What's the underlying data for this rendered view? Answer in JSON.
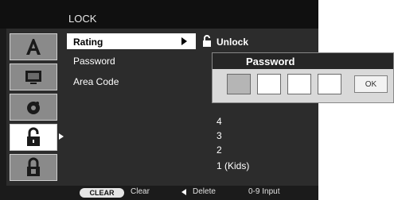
{
  "header": {
    "title": "LOCK"
  },
  "sidebar": {
    "tiles": [
      {
        "icon": "text-language-icon"
      },
      {
        "icon": "display-icon"
      },
      {
        "icon": "audio-disc-icon"
      },
      {
        "icon": "padlock-icon",
        "active": true
      },
      {
        "icon": "others-icon"
      }
    ]
  },
  "menu": {
    "items": [
      {
        "label": "Rating"
      },
      {
        "label": "Password"
      },
      {
        "label": "Area Code"
      }
    ]
  },
  "rating_options": {
    "unlock_label": "Unlock",
    "levels": [
      "4",
      "3",
      "2",
      "1 (Kids)"
    ]
  },
  "password_dialog": {
    "title": "Password",
    "box_count": 4,
    "ok_label": "OK"
  },
  "footer": {
    "clear_label": "CLEAR",
    "clear_hint": "Clear",
    "delete_hint": "Delete",
    "input_hint": "0-9 Input"
  }
}
